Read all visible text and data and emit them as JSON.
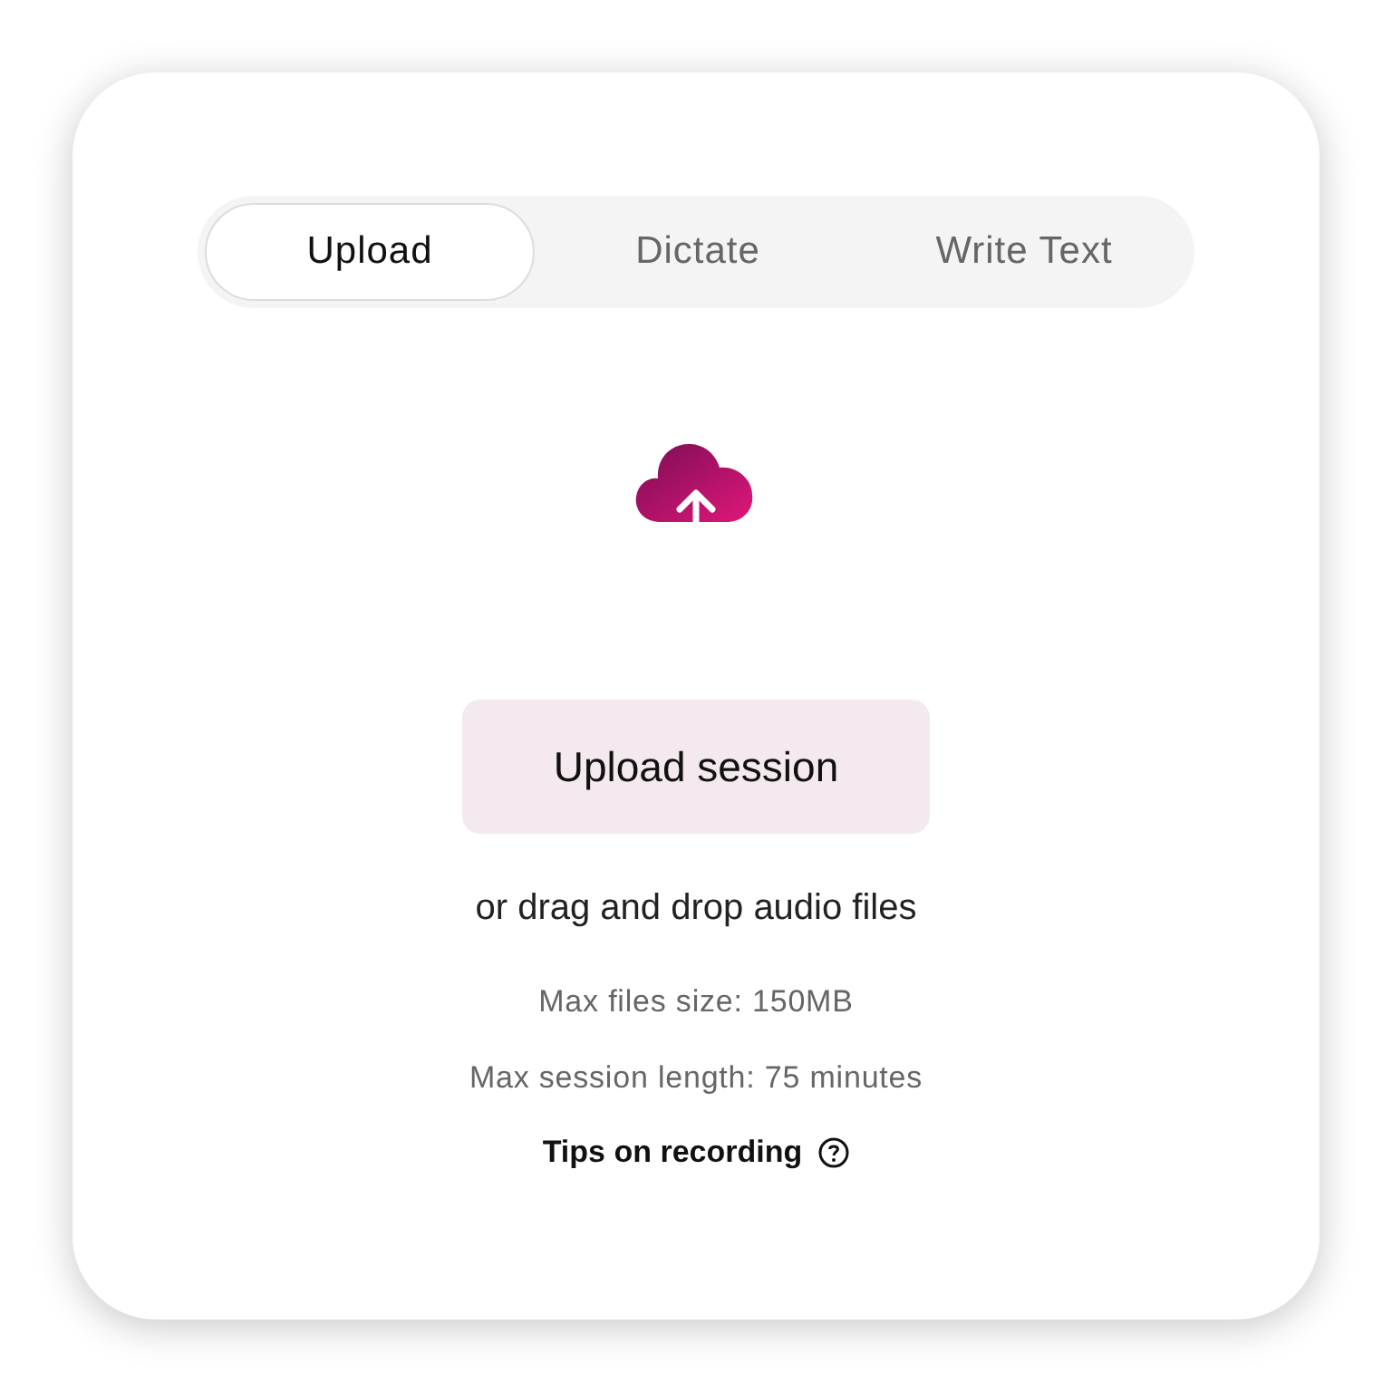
{
  "tabs": [
    {
      "label": "Upload",
      "selected": true
    },
    {
      "label": "Dictate",
      "selected": false
    },
    {
      "label": "Write Text",
      "selected": false
    }
  ],
  "upload_button": "Upload session",
  "drop_hint": "or drag and drop audio files",
  "limits": [
    "Max files size: 150MB",
    "Max session length: 75 minutes"
  ],
  "tips_link": "Tips on recording"
}
